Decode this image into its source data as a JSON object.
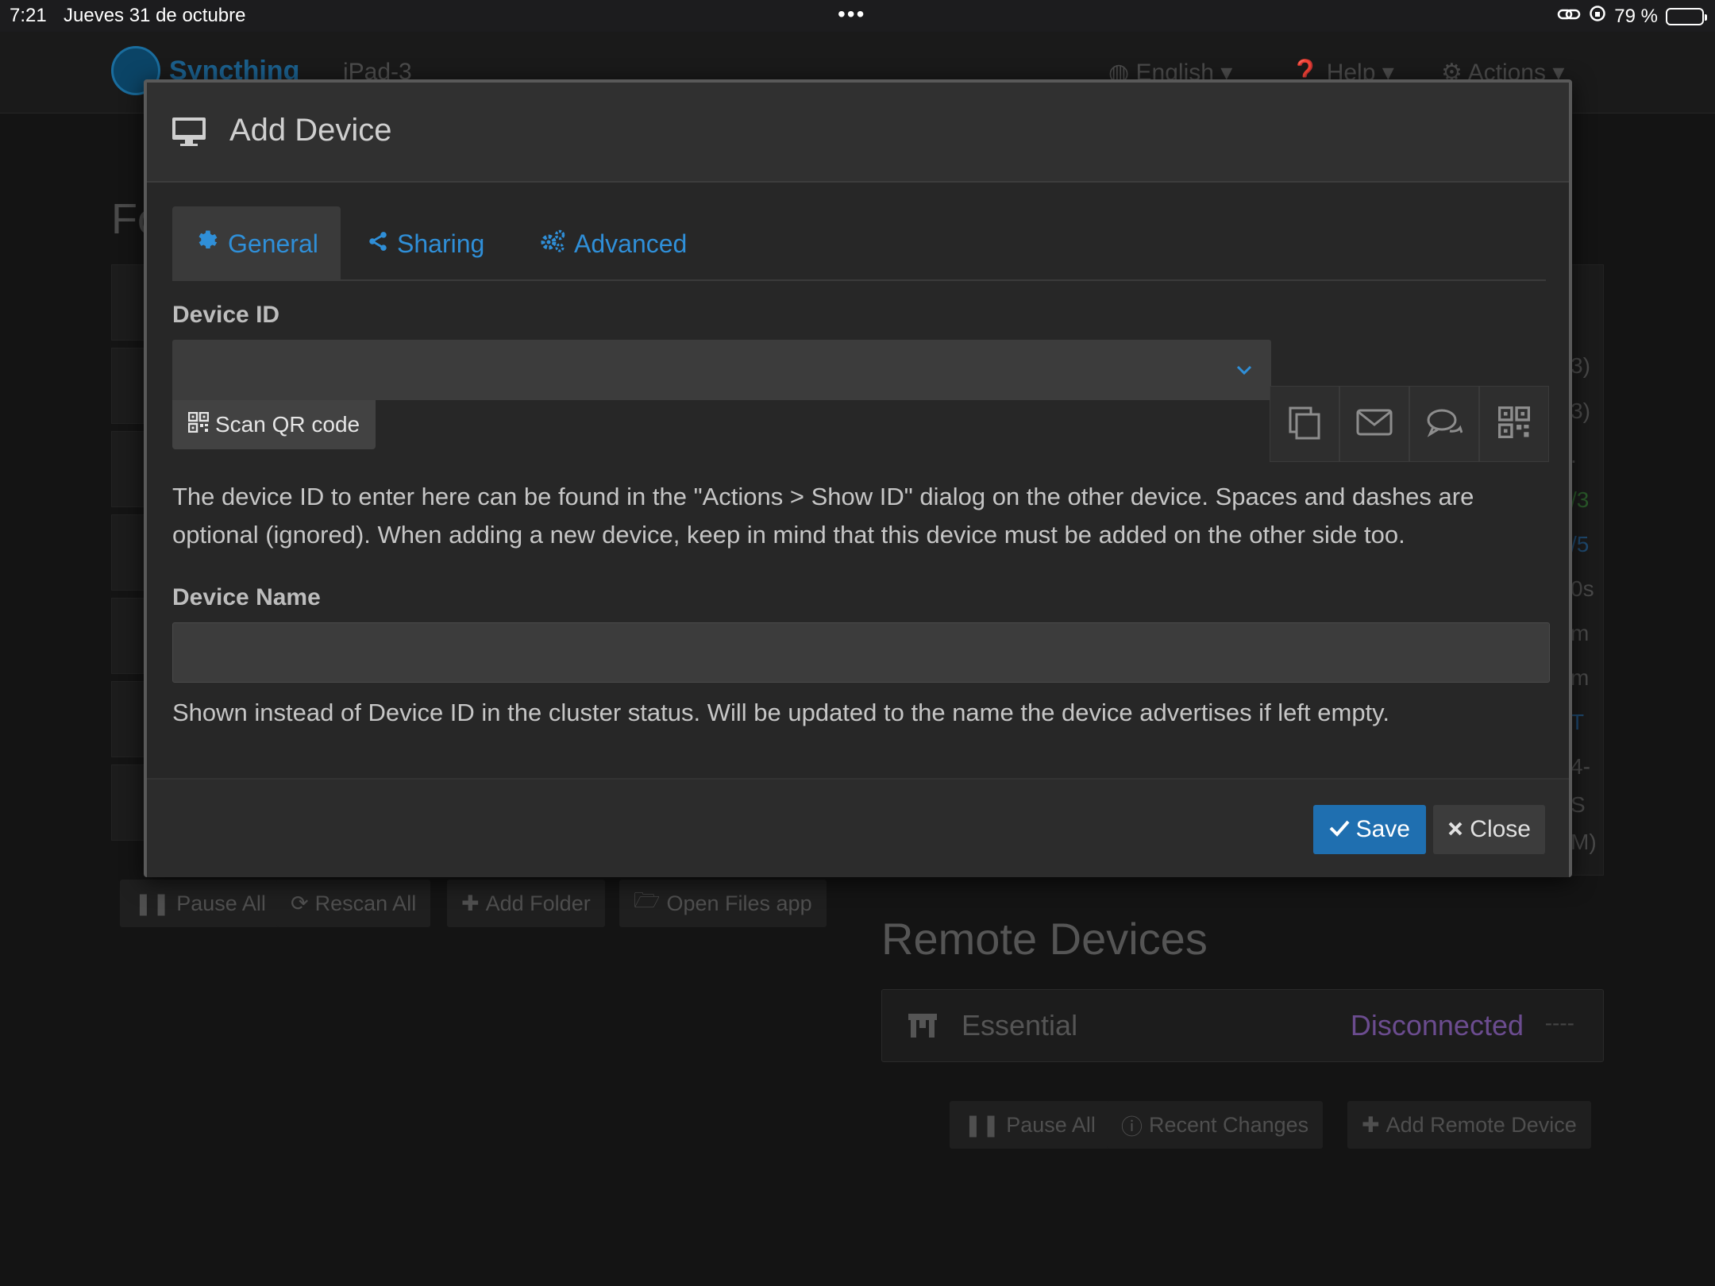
{
  "statusbar": {
    "time": "7:21",
    "date": "Jueves 31 de octubre",
    "dots": "•••",
    "battery_percent": "79 %",
    "battery_level": 0.79
  },
  "app": {
    "brand": "Syncthing",
    "host": "iPad-3",
    "nav": {
      "language": "English",
      "help": "Help",
      "actions": "Actions"
    },
    "folders_title_fragment": "Fo",
    "right_edge_fragments": [
      "3)",
      "3)",
      ".",
      "/3",
      "/5",
      "0s",
      "m",
      "m",
      "T",
      "4-",
      "S",
      "M)"
    ],
    "folder_buttons": {
      "pause_all": "Pause All",
      "rescan_all": "Rescan All",
      "add_folder": "Add Folder",
      "open_files": "Open Files app"
    },
    "remote_devices": {
      "title": "Remote Devices",
      "device_name": "Essential",
      "device_status": "Disconnected",
      "device_rate": "----",
      "status_color": "#6b4c8f"
    },
    "device_buttons": {
      "pause_all": "Pause All",
      "recent_changes": "Recent Changes",
      "add_remote": "Add Remote Device"
    }
  },
  "modal": {
    "title": "Add Device",
    "tabs": [
      {
        "label": "General",
        "active": true
      },
      {
        "label": "Sharing",
        "active": false
      },
      {
        "label": "Advanced",
        "active": false
      }
    ],
    "device_id_label": "Device ID",
    "device_id_value": "",
    "scan_qr_label": "Scan QR code",
    "device_id_help": "The device ID to enter here can be found in the \"Actions > Show ID\" dialog on the other device. Spaces and dashes are optional (ignored). When adding a new device, keep in mind that this device must be added on the other side too.",
    "device_name_label": "Device Name",
    "device_name_value": "",
    "device_name_help": "Shown instead of Device ID in the cluster status. Will be updated to the name the device advertises if left empty.",
    "save_label": "Save",
    "close_label": "Close",
    "accent_color": "#2f8fd8",
    "primary_button_color": "#1f6fb0"
  }
}
